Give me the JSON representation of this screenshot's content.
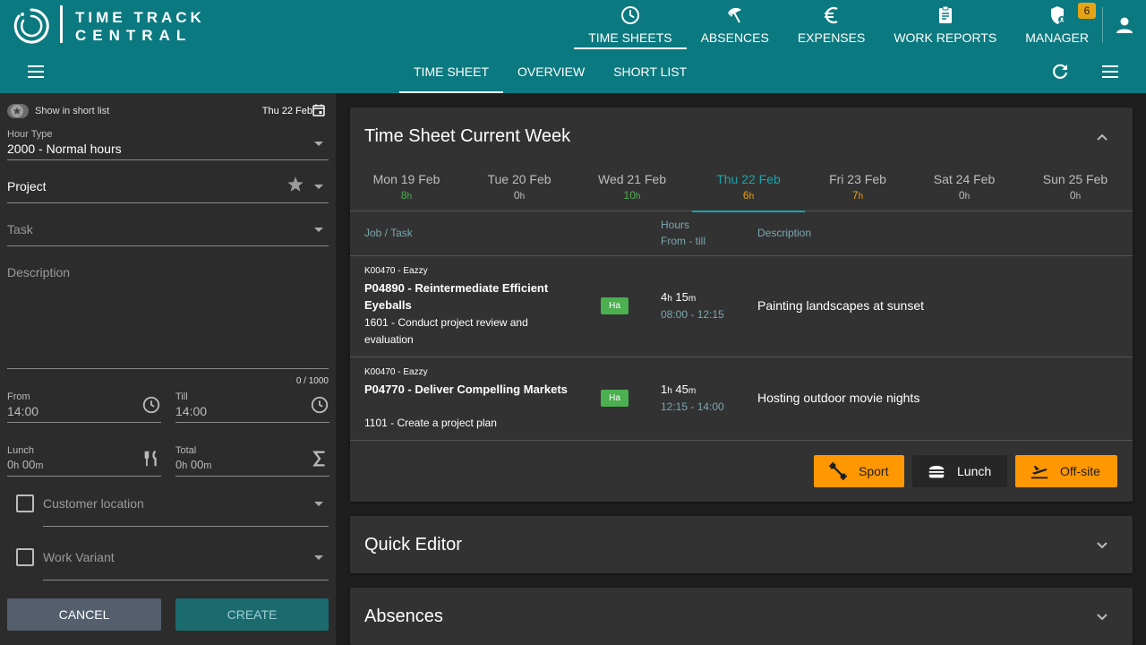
{
  "app": {
    "name_line1": "TIME TRACK",
    "name_line2": "CENTRAL"
  },
  "main_nav": [
    {
      "label": "TIME SHEETS",
      "icon": "clock-icon",
      "active": true
    },
    {
      "label": "ABSENCES",
      "icon": "beach-umbrella-icon"
    },
    {
      "label": "EXPENSES",
      "icon": "euro-icon"
    },
    {
      "label": "WORK REPORTS",
      "icon": "clipboard-icon"
    },
    {
      "label": "MANAGER",
      "icon": "shield-person-icon",
      "badge": "6"
    }
  ],
  "sub_tabs": [
    {
      "label": "TIME SHEET",
      "active": true
    },
    {
      "label": "OVERVIEW"
    },
    {
      "label": "SHORT LIST"
    }
  ],
  "form": {
    "shortlist_label": "Show in short list",
    "date": "Thu 22 Feb",
    "hour_type_label": "Hour Type",
    "hour_type_value": "2000 - Normal hours",
    "project_placeholder": "Project",
    "task_placeholder": "Task",
    "description_placeholder": "Description",
    "char_counter": "0 / 1000",
    "from_label": "From",
    "from_value": "14:00",
    "till_label": "Till",
    "till_value": "14:00",
    "lunch_label": "Lunch",
    "lunch_h": "0",
    "lunch_m": "00",
    "total_label": "Total",
    "total_h": "0",
    "total_m": "00",
    "customer_location_label": "Customer location",
    "work_variant_label": "Work Variant",
    "cancel_label": "CANCEL",
    "create_label": "CREATE"
  },
  "timesheet": {
    "title": "Time Sheet Current Week",
    "days": [
      {
        "name": "Mon 19 Feb",
        "hours": "8",
        "color": "#4caf50"
      },
      {
        "name": "Tue 20 Feb",
        "hours": "0",
        "color": "#bdbdbd"
      },
      {
        "name": "Wed 21 Feb",
        "hours": "10",
        "color": "#4caf50"
      },
      {
        "name": "Thu 22 Feb",
        "hours": "6",
        "color": "#e7a316",
        "active": true
      },
      {
        "name": "Fri 23 Feb",
        "hours": "7",
        "color": "#e7a316"
      },
      {
        "name": "Sat 24 Feb",
        "hours": "0",
        "color": "#bdbdbd"
      },
      {
        "name": "Sun 25 Feb",
        "hours": "0",
        "color": "#bdbdbd"
      }
    ],
    "hours_unit": "h",
    "minutes_unit": "m",
    "columns": {
      "job_task": "Job / Task",
      "hours": "Hours",
      "from_till": "From - till",
      "description": "Description"
    },
    "entries": [
      {
        "client": "K00470 - Eazzy",
        "project": "P04890 - Reintermediate Efficient Eyeballs",
        "task": "1601 - Conduct project review and evaluation",
        "tag": "Ha",
        "hours_h": "4",
        "hours_m": "15",
        "range": "08:00 - 12:15",
        "description": "Painting landscapes at sunset"
      },
      {
        "client": "K00470 - Eazzy",
        "project": "P04770 - Deliver Compelling Markets",
        "task": "1101 - Create a project plan",
        "tag": "Ha",
        "hours_h": "1",
        "hours_m": "45",
        "range": "12:15 - 14:00",
        "description": "Hosting outdoor movie nights"
      }
    ],
    "quick_buttons": [
      {
        "label": "Sport",
        "icon": "dumbbell-icon"
      },
      {
        "label": "Lunch",
        "icon": "burger-icon"
      },
      {
        "label": "Off-site",
        "icon": "airplane-icon"
      }
    ]
  },
  "quick_editor": {
    "title": "Quick Editor"
  },
  "absences": {
    "title": "Absences"
  }
}
